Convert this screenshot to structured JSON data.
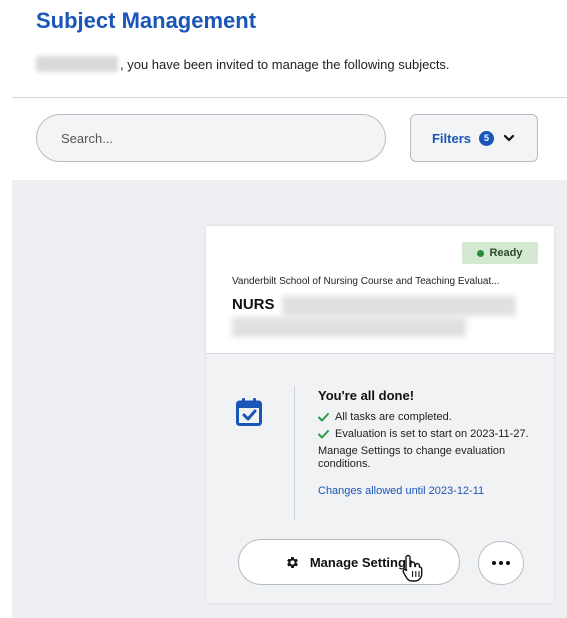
{
  "header": {
    "title": "Subject Management",
    "invite_text": ", you have been invited to manage the following subjects."
  },
  "search": {
    "placeholder": "Search..."
  },
  "filters": {
    "label": "Filters",
    "count": "5"
  },
  "card": {
    "status": "Ready",
    "survey_name": "Vanderbilt School of Nursing Course and Teaching Evaluat...",
    "course_code": "NURS",
    "done_title": "You're all done!",
    "checks": [
      "All tasks are completed.",
      "Evaluation is set to start on 2023-11-27."
    ],
    "manage_note": "Manage Settings to change evaluation conditions.",
    "changes_link": "Changes allowed until 2023-12-11",
    "manage_button": "Manage Settings"
  },
  "colors": {
    "brand": "#1a55b8",
    "status_ready": "#2e8b3a",
    "status_bg": "#d5e8d2",
    "check": "#2e9a4a"
  },
  "icons": {
    "calendar": "calendar-check-icon",
    "gear": "gear-icon",
    "more": "more-horizontal-icon",
    "chevron": "chevron-down-icon",
    "cursor": "hand-pointer-cursor"
  }
}
